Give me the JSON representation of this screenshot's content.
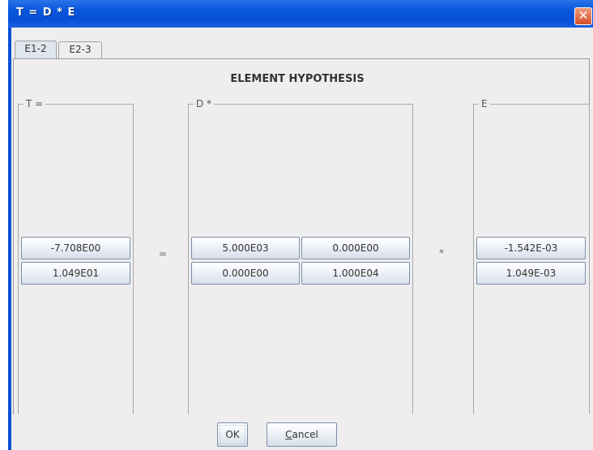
{
  "window": {
    "title": "T = D * E",
    "close_glyph": "✕"
  },
  "tabs": [
    {
      "label": "E1-2",
      "selected": true
    },
    {
      "label": "E2-3",
      "selected": false
    }
  ],
  "panel": {
    "heading": "ELEMENT HYPOTHESIS"
  },
  "groups": {
    "t": {
      "label": "T =",
      "values": [
        "-7.708E00",
        "1.049E01"
      ]
    },
    "d": {
      "label": "D *",
      "values": [
        [
          "5.000E03",
          "0.000E00"
        ],
        [
          "0.000E00",
          "1.000E04"
        ]
      ]
    },
    "e": {
      "label": "E",
      "values": [
        "-1.542E-03",
        "1.049E-03"
      ]
    }
  },
  "operators": {
    "equals": "=",
    "times": "*"
  },
  "buttons": {
    "ok": "OK",
    "cancel_mnemonic": "C",
    "cancel_rest": "ancel"
  },
  "icons": {
    "close": "close-icon"
  }
}
